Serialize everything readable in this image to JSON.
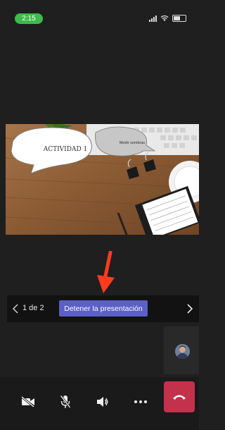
{
  "status_bar": {
    "time": "2:15"
  },
  "slide": {
    "bubble_main_text": "ACTIVIDAD 1",
    "bubble_secondary_text": "Medir sombras"
  },
  "presentation_bar": {
    "page_indicator": "1 de 2",
    "stop_label": "Detener la presentación"
  },
  "controls": {
    "icons": [
      "video-off-icon",
      "mic-off-icon",
      "speaker-icon",
      "more-icon",
      "hang-up-icon"
    ]
  },
  "colors": {
    "accent": "#5b5fc7",
    "hangup": "#c4314b",
    "time_pill": "#3dbb4c",
    "annotation_arrow": "#ff3b1f"
  }
}
